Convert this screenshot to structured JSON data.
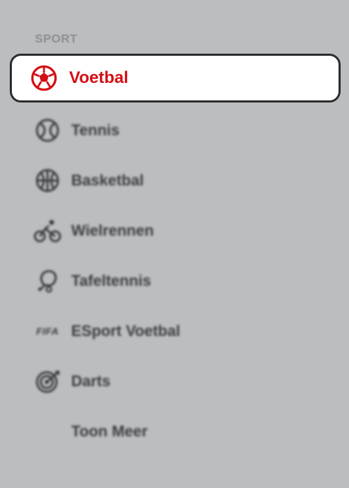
{
  "section_title": "SPORT",
  "active": {
    "label": "Voetbal",
    "icon": "soccer-ball-icon",
    "color": "#d40f14"
  },
  "items": [
    {
      "label": "Tennis",
      "icon": "tennis-ball-icon"
    },
    {
      "label": "Basketbal",
      "icon": "basketball-icon"
    },
    {
      "label": "Wielrennen",
      "icon": "cyclist-icon"
    },
    {
      "label": "Tafeltennis",
      "icon": "table-tennis-icon"
    },
    {
      "label": "ESport Voetbal",
      "icon": "fifa-icon",
      "icon_text": "FIFA"
    },
    {
      "label": "Darts",
      "icon": "dartboard-icon"
    },
    {
      "label": "Toon Meer"
    }
  ]
}
